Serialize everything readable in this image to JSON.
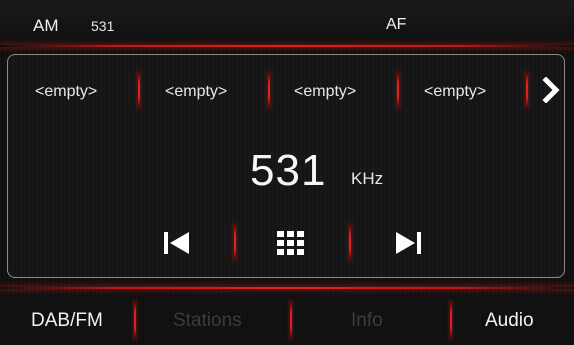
{
  "status_bar": {
    "band": "AM",
    "frequency": "531",
    "af": "AF"
  },
  "presets": [
    "<empty>",
    "<empty>",
    "<empty>",
    "<empty>"
  ],
  "tuner": {
    "frequency": "531",
    "unit": "KHz"
  },
  "controls": {
    "prev": "previous-icon",
    "grid": "grid-icon",
    "next": "next-icon",
    "more": "chevron-right-icon"
  },
  "bottom_nav": {
    "dab_fm": "DAB/FM",
    "stations": "Stations",
    "info": "Info",
    "audio": "Audio"
  },
  "colors": {
    "accent_red": "#e02020",
    "text": "#f2f2f2",
    "disabled": "#3c3c3c"
  }
}
